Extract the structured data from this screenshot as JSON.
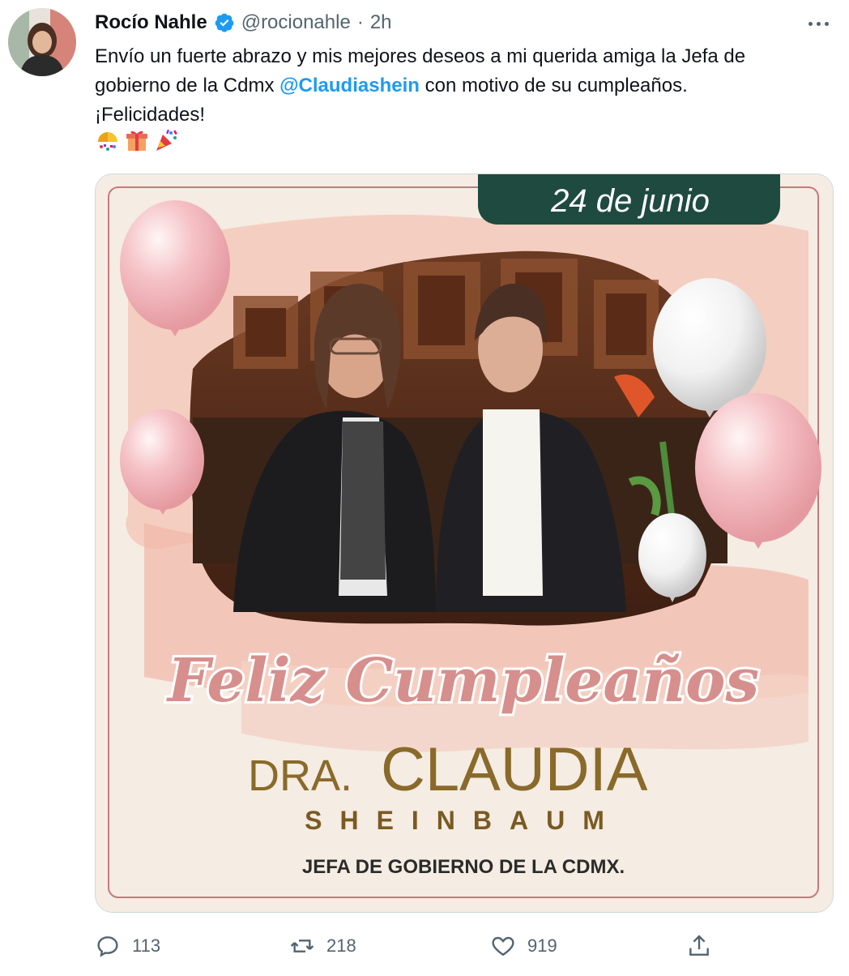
{
  "tweet": {
    "author_name": "Rocío Nahle",
    "handle": "@rocionahle",
    "separator": "·",
    "time": "2h",
    "text_part1": "Envío un fuerte abrazo y mis mejores deseos a mi querida amiga la Jefa de gobierno de la Cdmx ",
    "mention": "@Claudiashein",
    "text_part2": " con motivo de su cumpleaños.",
    "text_line3": "¡Felicidades!",
    "emojis": [
      "confetti-ball-icon",
      "gift-icon",
      "party-popper-icon"
    ]
  },
  "media": {
    "date_banner": "24 de junio",
    "greeting": "Feliz Cumpleaños",
    "title_prefix": "DRA.",
    "first_name": "CLAUDIA",
    "last_name": "SHEINBAUM",
    "role": "JEFA DE GOBIERNO DE LA CDMX."
  },
  "actions": {
    "replies": "113",
    "retweets": "218",
    "likes": "919"
  },
  "colors": {
    "link": "#1d9bf0",
    "muted": "#536471",
    "banner_green": "#1f4a3f",
    "gold": "#8a6a2a",
    "greeting_pink": "#d68f8c"
  }
}
